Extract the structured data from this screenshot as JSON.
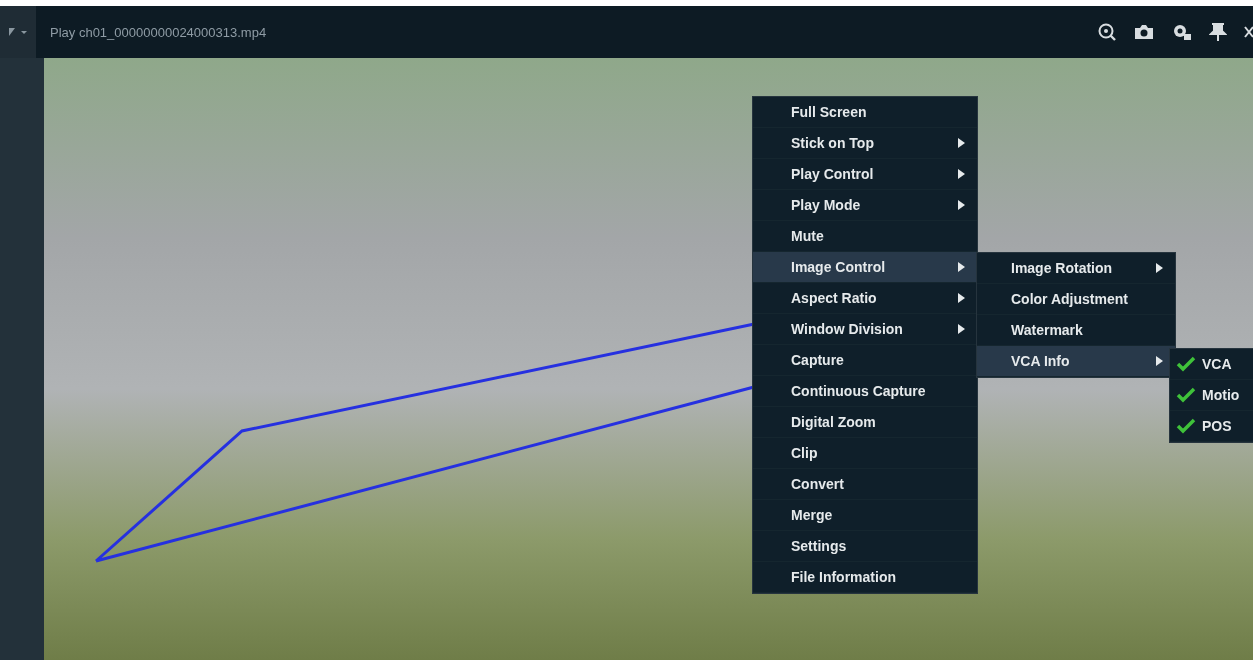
{
  "title_bar": {
    "title": "Play ch01_00000000024000313.mp4"
  },
  "context_menu": {
    "items": [
      {
        "label": "Full Screen",
        "submenu": false,
        "selected": false
      },
      {
        "label": "Stick on Top",
        "submenu": true,
        "selected": false
      },
      {
        "label": "Play Control",
        "submenu": true,
        "selected": false
      },
      {
        "label": "Play Mode",
        "submenu": true,
        "selected": false
      },
      {
        "label": "Mute",
        "submenu": false,
        "selected": false
      },
      {
        "label": "Image Control",
        "submenu": true,
        "selected": true
      },
      {
        "label": "Aspect Ratio",
        "submenu": true,
        "selected": false
      },
      {
        "label": "Window Division",
        "submenu": true,
        "selected": false
      },
      {
        "label": "Capture",
        "submenu": false,
        "selected": false
      },
      {
        "label": "Continuous Capture",
        "submenu": false,
        "selected": false
      },
      {
        "label": "Digital Zoom",
        "submenu": false,
        "selected": false
      },
      {
        "label": "Clip",
        "submenu": false,
        "selected": false
      },
      {
        "label": "Convert",
        "submenu": false,
        "selected": false
      },
      {
        "label": "Merge",
        "submenu": false,
        "selected": false
      },
      {
        "label": "Settings",
        "submenu": false,
        "selected": false
      },
      {
        "label": "File Information",
        "submenu": false,
        "selected": false
      }
    ]
  },
  "image_control_menu": {
    "items": [
      {
        "label": "Image Rotation",
        "submenu": true,
        "selected": false
      },
      {
        "label": "Color Adjustment",
        "submenu": false,
        "selected": false
      },
      {
        "label": "Watermark",
        "submenu": false,
        "selected": false
      },
      {
        "label": "VCA Info",
        "submenu": true,
        "selected": true
      }
    ]
  },
  "vca_info_menu": {
    "items": [
      {
        "label": "VCA",
        "checked": true
      },
      {
        "label": "Motio",
        "checked": true
      },
      {
        "label": "POS",
        "checked": true
      }
    ]
  }
}
